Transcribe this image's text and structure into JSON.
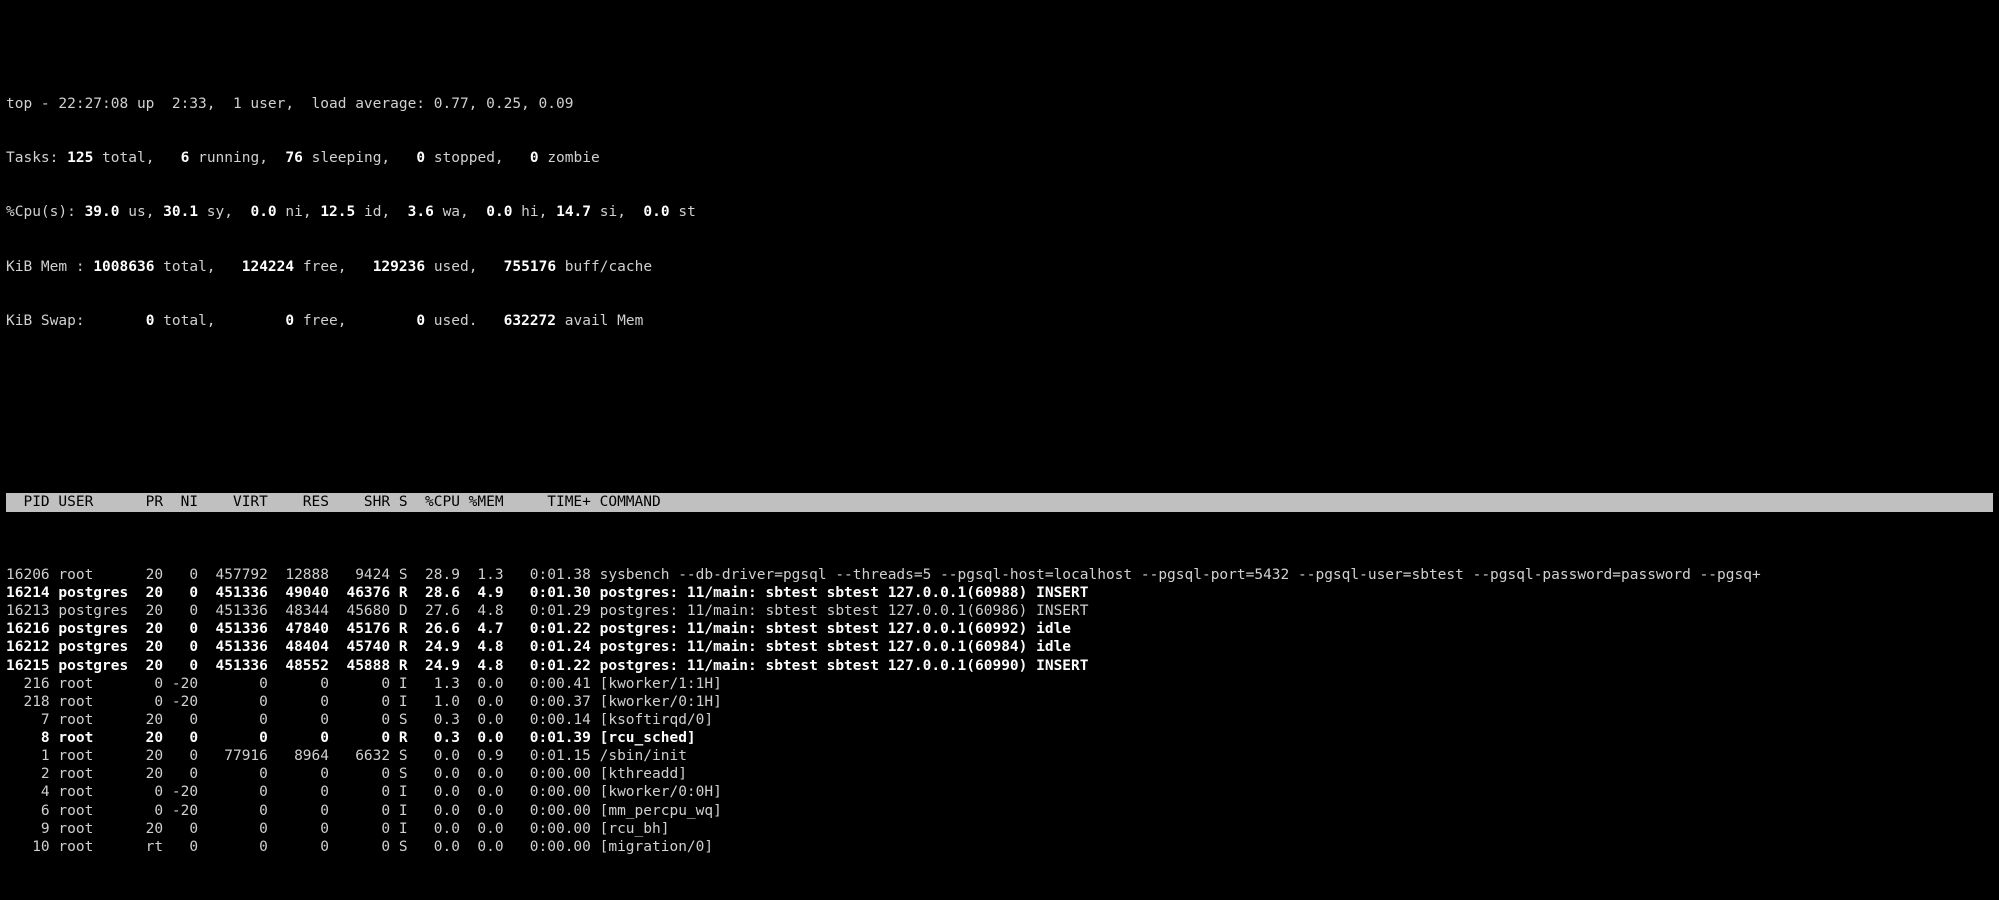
{
  "summary": {
    "line1_a": "top - 22:27:08 up  2:33,  1 user,  load average: 0.77, 0.25, 0.09",
    "tasks_a": "Tasks: ",
    "tasks_total": "125",
    "tasks_b": " total,   ",
    "tasks_running": "6",
    "tasks_c": " running,  ",
    "tasks_sleeping": "76",
    "tasks_d": " sleeping,   ",
    "tasks_stopped": "0",
    "tasks_e": " stopped,   ",
    "tasks_zombie": "0",
    "tasks_f": " zombie",
    "cpu_a": "%Cpu(s): ",
    "cpu_us": "39.0",
    "cpu_b": " us, ",
    "cpu_sy": "30.1",
    "cpu_c": " sy,  ",
    "cpu_ni": "0.0",
    "cpu_d": " ni, ",
    "cpu_id": "12.5",
    "cpu_e": " id,  ",
    "cpu_wa": "3.6",
    "cpu_f": " wa,  ",
    "cpu_hi": "0.0",
    "cpu_g": " hi, ",
    "cpu_si": "14.7",
    "cpu_h": " si,  ",
    "cpu_st": "0.0",
    "cpu_i": " st",
    "mem_a": "KiB Mem : ",
    "mem_total": "1008636",
    "mem_b": " total,   ",
    "mem_free": "124224",
    "mem_c": " free,   ",
    "mem_used": "129236",
    "mem_d": " used,   ",
    "mem_buff": "755176",
    "mem_e": " buff/cache",
    "swap_a": "KiB Swap:       ",
    "swap_total": "0",
    "swap_b": " total,        ",
    "swap_free": "0",
    "swap_c": " free,        ",
    "swap_used": "0",
    "swap_d": " used.   ",
    "swap_avail": "632272",
    "swap_e": " avail Mem "
  },
  "header": "  PID USER      PR  NI    VIRT    RES    SHR S  %CPU %MEM     TIME+ COMMAND                                                                                                                                                        ",
  "rows": [
    {
      "bold": false,
      "text": "16206 root      20   0  457792  12888   9424 S  28.9  1.3   0:01.38 sysbench --db-driver=pgsql --threads=5 --pgsql-host=localhost --pgsql-port=5432 --pgsql-user=sbtest --pgsql-password=password --pgsq+"
    },
    {
      "bold": true,
      "text": "16214 postgres  20   0  451336  49040  46376 R  28.6  4.9   0:01.30 postgres: 11/main: sbtest sbtest 127.0.0.1(60988) INSERT"
    },
    {
      "bold": false,
      "text": "16213 postgres  20   0  451336  48344  45680 D  27.6  4.8   0:01.29 postgres: 11/main: sbtest sbtest 127.0.0.1(60986) INSERT"
    },
    {
      "bold": true,
      "text": "16216 postgres  20   0  451336  47840  45176 R  26.6  4.7   0:01.22 postgres: 11/main: sbtest sbtest 127.0.0.1(60992) idle"
    },
    {
      "bold": true,
      "text": "16212 postgres  20   0  451336  48404  45740 R  24.9  4.8   0:01.24 postgres: 11/main: sbtest sbtest 127.0.0.1(60984) idle"
    },
    {
      "bold": true,
      "text": "16215 postgres  20   0  451336  48552  45888 R  24.9  4.8   0:01.22 postgres: 11/main: sbtest sbtest 127.0.0.1(60990) INSERT"
    },
    {
      "bold": false,
      "text": "  216 root       0 -20       0      0      0 I   1.3  0.0   0:00.41 [kworker/1:1H]"
    },
    {
      "bold": false,
      "text": "  218 root       0 -20       0      0      0 I   1.0  0.0   0:00.37 [kworker/0:1H]"
    },
    {
      "bold": false,
      "text": "    7 root      20   0       0      0      0 S   0.3  0.0   0:00.14 [ksoftirqd/0]"
    },
    {
      "bold": true,
      "text": "    8 root      20   0       0      0      0 R   0.3  0.0   0:01.39 [rcu_sched]"
    },
    {
      "bold": false,
      "text": "    1 root      20   0   77916   8964   6632 S   0.0  0.9   0:01.15 /sbin/init"
    },
    {
      "bold": false,
      "text": "    2 root      20   0       0      0      0 S   0.0  0.0   0:00.00 [kthreadd]"
    },
    {
      "bold": false,
      "text": "    4 root       0 -20       0      0      0 I   0.0  0.0   0:00.00 [kworker/0:0H]"
    },
    {
      "bold": false,
      "text": "    6 root       0 -20       0      0      0 I   0.0  0.0   0:00.00 [mm_percpu_wq]"
    },
    {
      "bold": false,
      "text": "    9 root      20   0       0      0      0 I   0.0  0.0   0:00.00 [rcu_bh]"
    },
    {
      "bold": false,
      "text": "   10 root      rt   0       0      0      0 S   0.0  0.0   0:00.00 [migration/0]"
    }
  ]
}
